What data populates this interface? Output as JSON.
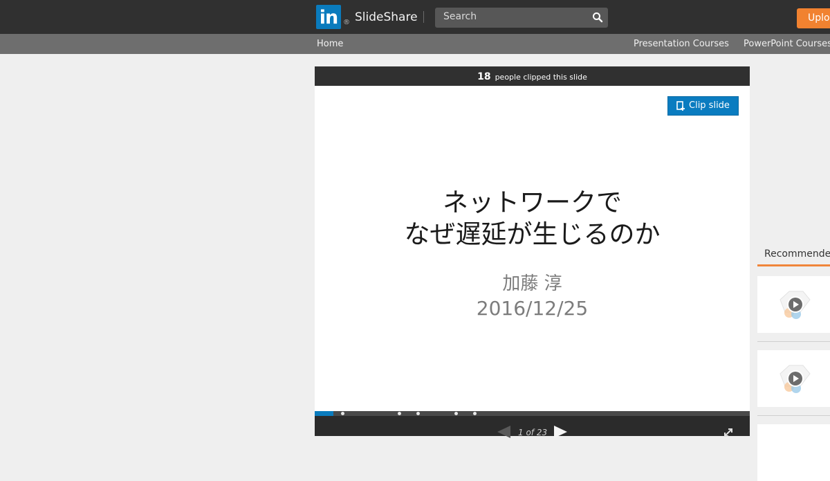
{
  "header": {
    "logo_text": "in",
    "registered_mark": "®",
    "brand": "SlideShare",
    "search_placeholder": "Search",
    "upload_label": "Upload"
  },
  "subnav": {
    "home": "Home",
    "links": [
      "Presentation Courses",
      "PowerPoint Courses"
    ]
  },
  "player": {
    "clip_count": "18",
    "clip_text": "people clipped this slide",
    "clip_button": "Clip slide",
    "slide_title_line1": "ネットワークで",
    "slide_title_line2": "なぜ遅延が生じるのか",
    "slide_author": "加藤 淳",
    "slide_date": "2016/12/25",
    "page_indicator": "1 of 23",
    "current_page": 1,
    "total_pages": 23,
    "progress_fraction": 0.043
  },
  "sidebar": {
    "recommended_label": "Recommended"
  },
  "colors": {
    "accent": "#0a7bbd",
    "upload": "#f18230",
    "topbar": "#303030",
    "subnav": "#6e6e6e",
    "tab_underline": "#f0853a"
  }
}
